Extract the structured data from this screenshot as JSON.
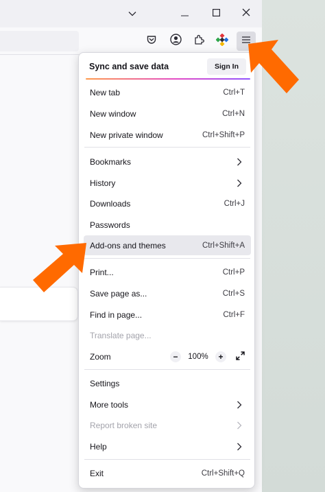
{
  "menu": {
    "header": {
      "title": "Sync and save data",
      "signin_label": "Sign In"
    },
    "items": [
      {
        "label": "New tab",
        "shortcut": "Ctrl+T"
      },
      {
        "label": "New window",
        "shortcut": "Ctrl+N"
      },
      {
        "label": "New private window",
        "shortcut": "Ctrl+Shift+P"
      },
      {
        "label": "Bookmarks",
        "shortcut": ""
      },
      {
        "label": "History",
        "shortcut": ""
      },
      {
        "label": "Downloads",
        "shortcut": "Ctrl+J"
      },
      {
        "label": "Passwords",
        "shortcut": ""
      },
      {
        "label": "Add-ons and themes",
        "shortcut": "Ctrl+Shift+A",
        "highlighted": true
      },
      {
        "label": "Print...",
        "shortcut": "Ctrl+P"
      },
      {
        "label": "Save page as...",
        "shortcut": "Ctrl+S"
      },
      {
        "label": "Find in page...",
        "shortcut": "Ctrl+F"
      },
      {
        "label": "Translate page...",
        "shortcut": "",
        "disabled": true
      },
      {
        "label": "Zoom",
        "shortcut": ""
      },
      {
        "label": "Settings",
        "shortcut": ""
      },
      {
        "label": "More tools",
        "shortcut": ""
      },
      {
        "label": "Report broken site",
        "shortcut": "",
        "disabled": true
      },
      {
        "label": "Help",
        "shortcut": ""
      },
      {
        "label": "Exit",
        "shortcut": "Ctrl+Shift+Q"
      }
    ],
    "zoom": {
      "decrease": "−",
      "value": "100%",
      "increase": "+"
    }
  },
  "toolbar": {
    "icons": [
      "pocket-icon",
      "account-icon",
      "extensions-icon",
      "colorful-extension-icon",
      "menu-hamburger-icon"
    ]
  },
  "titlebar": {
    "icons": [
      "list-all-tabs-icon",
      "minimize-icon",
      "maximize-icon",
      "close-icon"
    ]
  },
  "annotations": {
    "arrow_color": "#ff6a00"
  },
  "colors": {
    "accent_start": "#ff9a4a",
    "accent_mid": "#e34bc6",
    "accent_end": "#8f52ff"
  }
}
